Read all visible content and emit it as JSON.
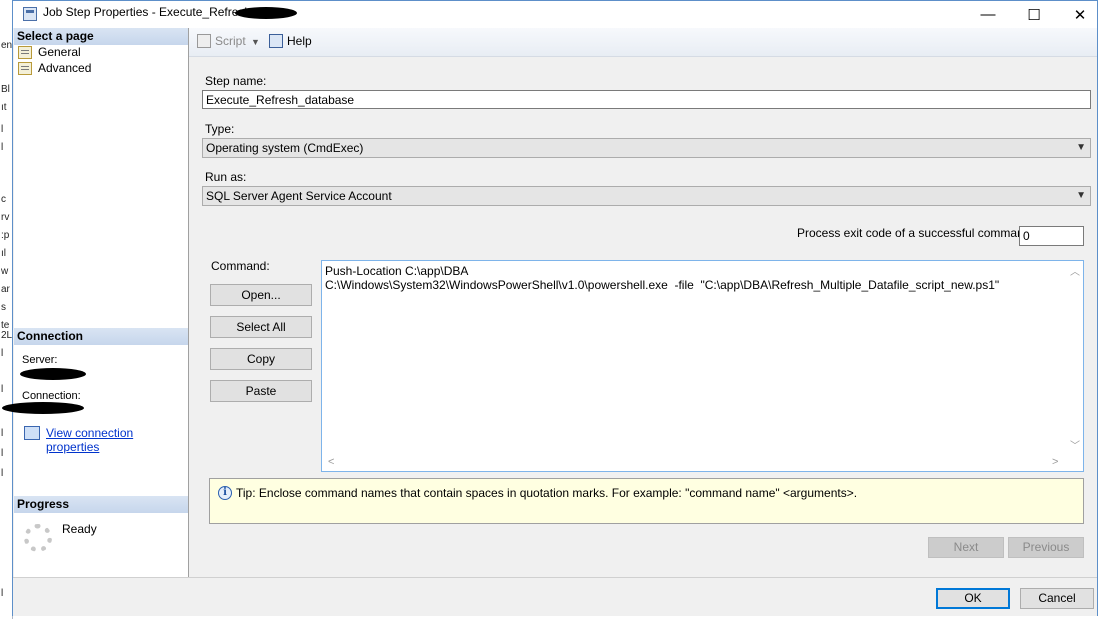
{
  "window": {
    "title": "Job Step Properties - Execute_Refresh"
  },
  "window_controls": {
    "minimize": "—",
    "maximize": "☐",
    "close": "✕"
  },
  "background_window": {
    "fragments": [
      "en",
      "Bl",
      "ıt",
      "l",
      "l",
      "c",
      "rv",
      ":p",
      "ıl",
      "w",
      "ar",
      "s",
      "te",
      "2L",
      "l",
      "l",
      "l",
      "l",
      "l",
      "l"
    ]
  },
  "left_panel": {
    "select_page_header": "Select a page",
    "pages": [
      {
        "label": "General"
      },
      {
        "label": "Advanced"
      }
    ],
    "connection_header": "Connection",
    "server_label": "Server:",
    "connection_label": "Connection:",
    "view_connection_link": "View connection properties",
    "progress_header": "Progress",
    "progress_status": "Ready"
  },
  "toolbar": {
    "script_label": "Script",
    "script_dropdown": "▼",
    "help_label": "Help"
  },
  "form": {
    "step_name_label": "Step name:",
    "step_name_value": "Execute_Refresh_database",
    "type_label": "Type:",
    "type_value": "Operating system (CmdExec)",
    "run_as_label": "Run as:",
    "run_as_value": "SQL Server Agent Service Account",
    "exit_code_label": "Process exit code of a successful command:",
    "exit_code_value": "0",
    "command_label": "Command:",
    "command_lines": [
      "Push-Location C:\\app\\DBA",
      "C:\\Windows\\System32\\WindowsPowerShell\\v1.0\\powershell.exe  -file  \"C:\\app\\DBA\\Refresh_Multiple_Datafile_script_new.ps1\""
    ],
    "buttons": {
      "open": "Open...",
      "select_all": "Select All",
      "copy": "Copy",
      "paste": "Paste"
    },
    "tip_icon": "i",
    "tip_text": "Tip: Enclose command names that contain spaces in quotation marks. For example: \"command name\" <arguments>.",
    "next_label": "Next",
    "previous_label": "Previous"
  },
  "scroll_arrows": {
    "up": "︿",
    "down": "﹀",
    "left": "<",
    "right": ">"
  },
  "dialog": {
    "ok_label": "OK",
    "cancel_label": "Cancel"
  },
  "icons": {
    "window": "app-window-icon",
    "general": "properties-page-icon",
    "advanced": "properties-page-icon",
    "connection": "connection-properties-icon",
    "progress": "progress-spinner-icon",
    "script": "script-icon",
    "help": "help-icon",
    "tip": "info-icon",
    "combo": "chevron-down-icon"
  },
  "colors": {
    "window_border": "#5d8fc9",
    "section_header": "#c6d6ec",
    "link": "#0033cc",
    "tip_background": "#ffffe1",
    "focus_border": "#0078d7"
  }
}
